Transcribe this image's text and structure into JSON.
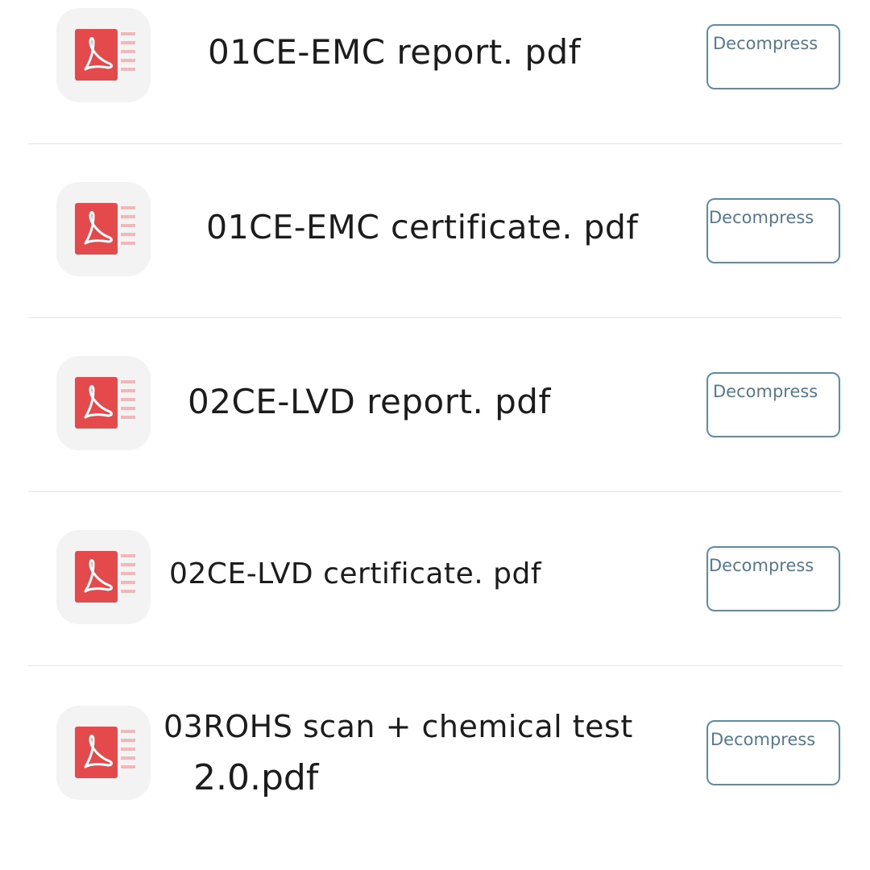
{
  "colors": {
    "pdf_red": "#e4494b",
    "button_border": "#5b8ea5",
    "button_text": "#56788d",
    "text": "#1c1c1c"
  },
  "files": [
    {
      "name": "01CE-EMC report. pdf",
      "icon": "pdf-file-icon",
      "button_label": "Decompress"
    },
    {
      "name": "01CE-EMC certificate. pdf",
      "icon": "pdf-file-icon",
      "button_label": "Decompress"
    },
    {
      "name": "02CE-LVD report. pdf",
      "icon": "pdf-file-icon",
      "button_label": "Decompress"
    },
    {
      "name": "02CE-LVD certificate. pdf",
      "icon": "pdf-file-icon",
      "button_label": "Decompress"
    },
    {
      "name_line1": "03ROHS scan + chemical test",
      "name_line2": "2.0.pdf",
      "icon": "pdf-file-icon",
      "button_label": "Decompress"
    }
  ]
}
